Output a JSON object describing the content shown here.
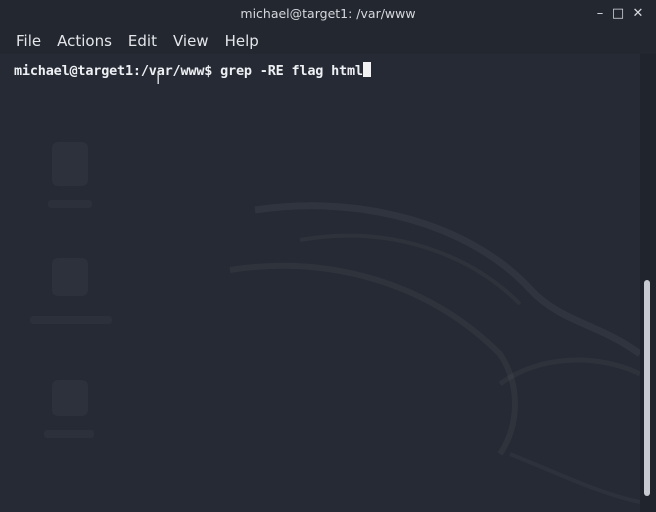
{
  "window": {
    "title": "michael@target1: /var/www",
    "minimize_glyph": "–",
    "maximize_glyph": "□",
    "close_glyph": "✕"
  },
  "menu": {
    "items": [
      {
        "label": "File"
      },
      {
        "label": "Actions"
      },
      {
        "label": "Edit"
      },
      {
        "label": "View"
      },
      {
        "label": "Help"
      }
    ]
  },
  "terminal": {
    "prompt": "michael@target1:/var/www$ ",
    "command": "grep -RE flag html",
    "cursor_icon": "text-cursor-icon"
  },
  "scrollbar": {
    "position_fraction": 0.5
  }
}
